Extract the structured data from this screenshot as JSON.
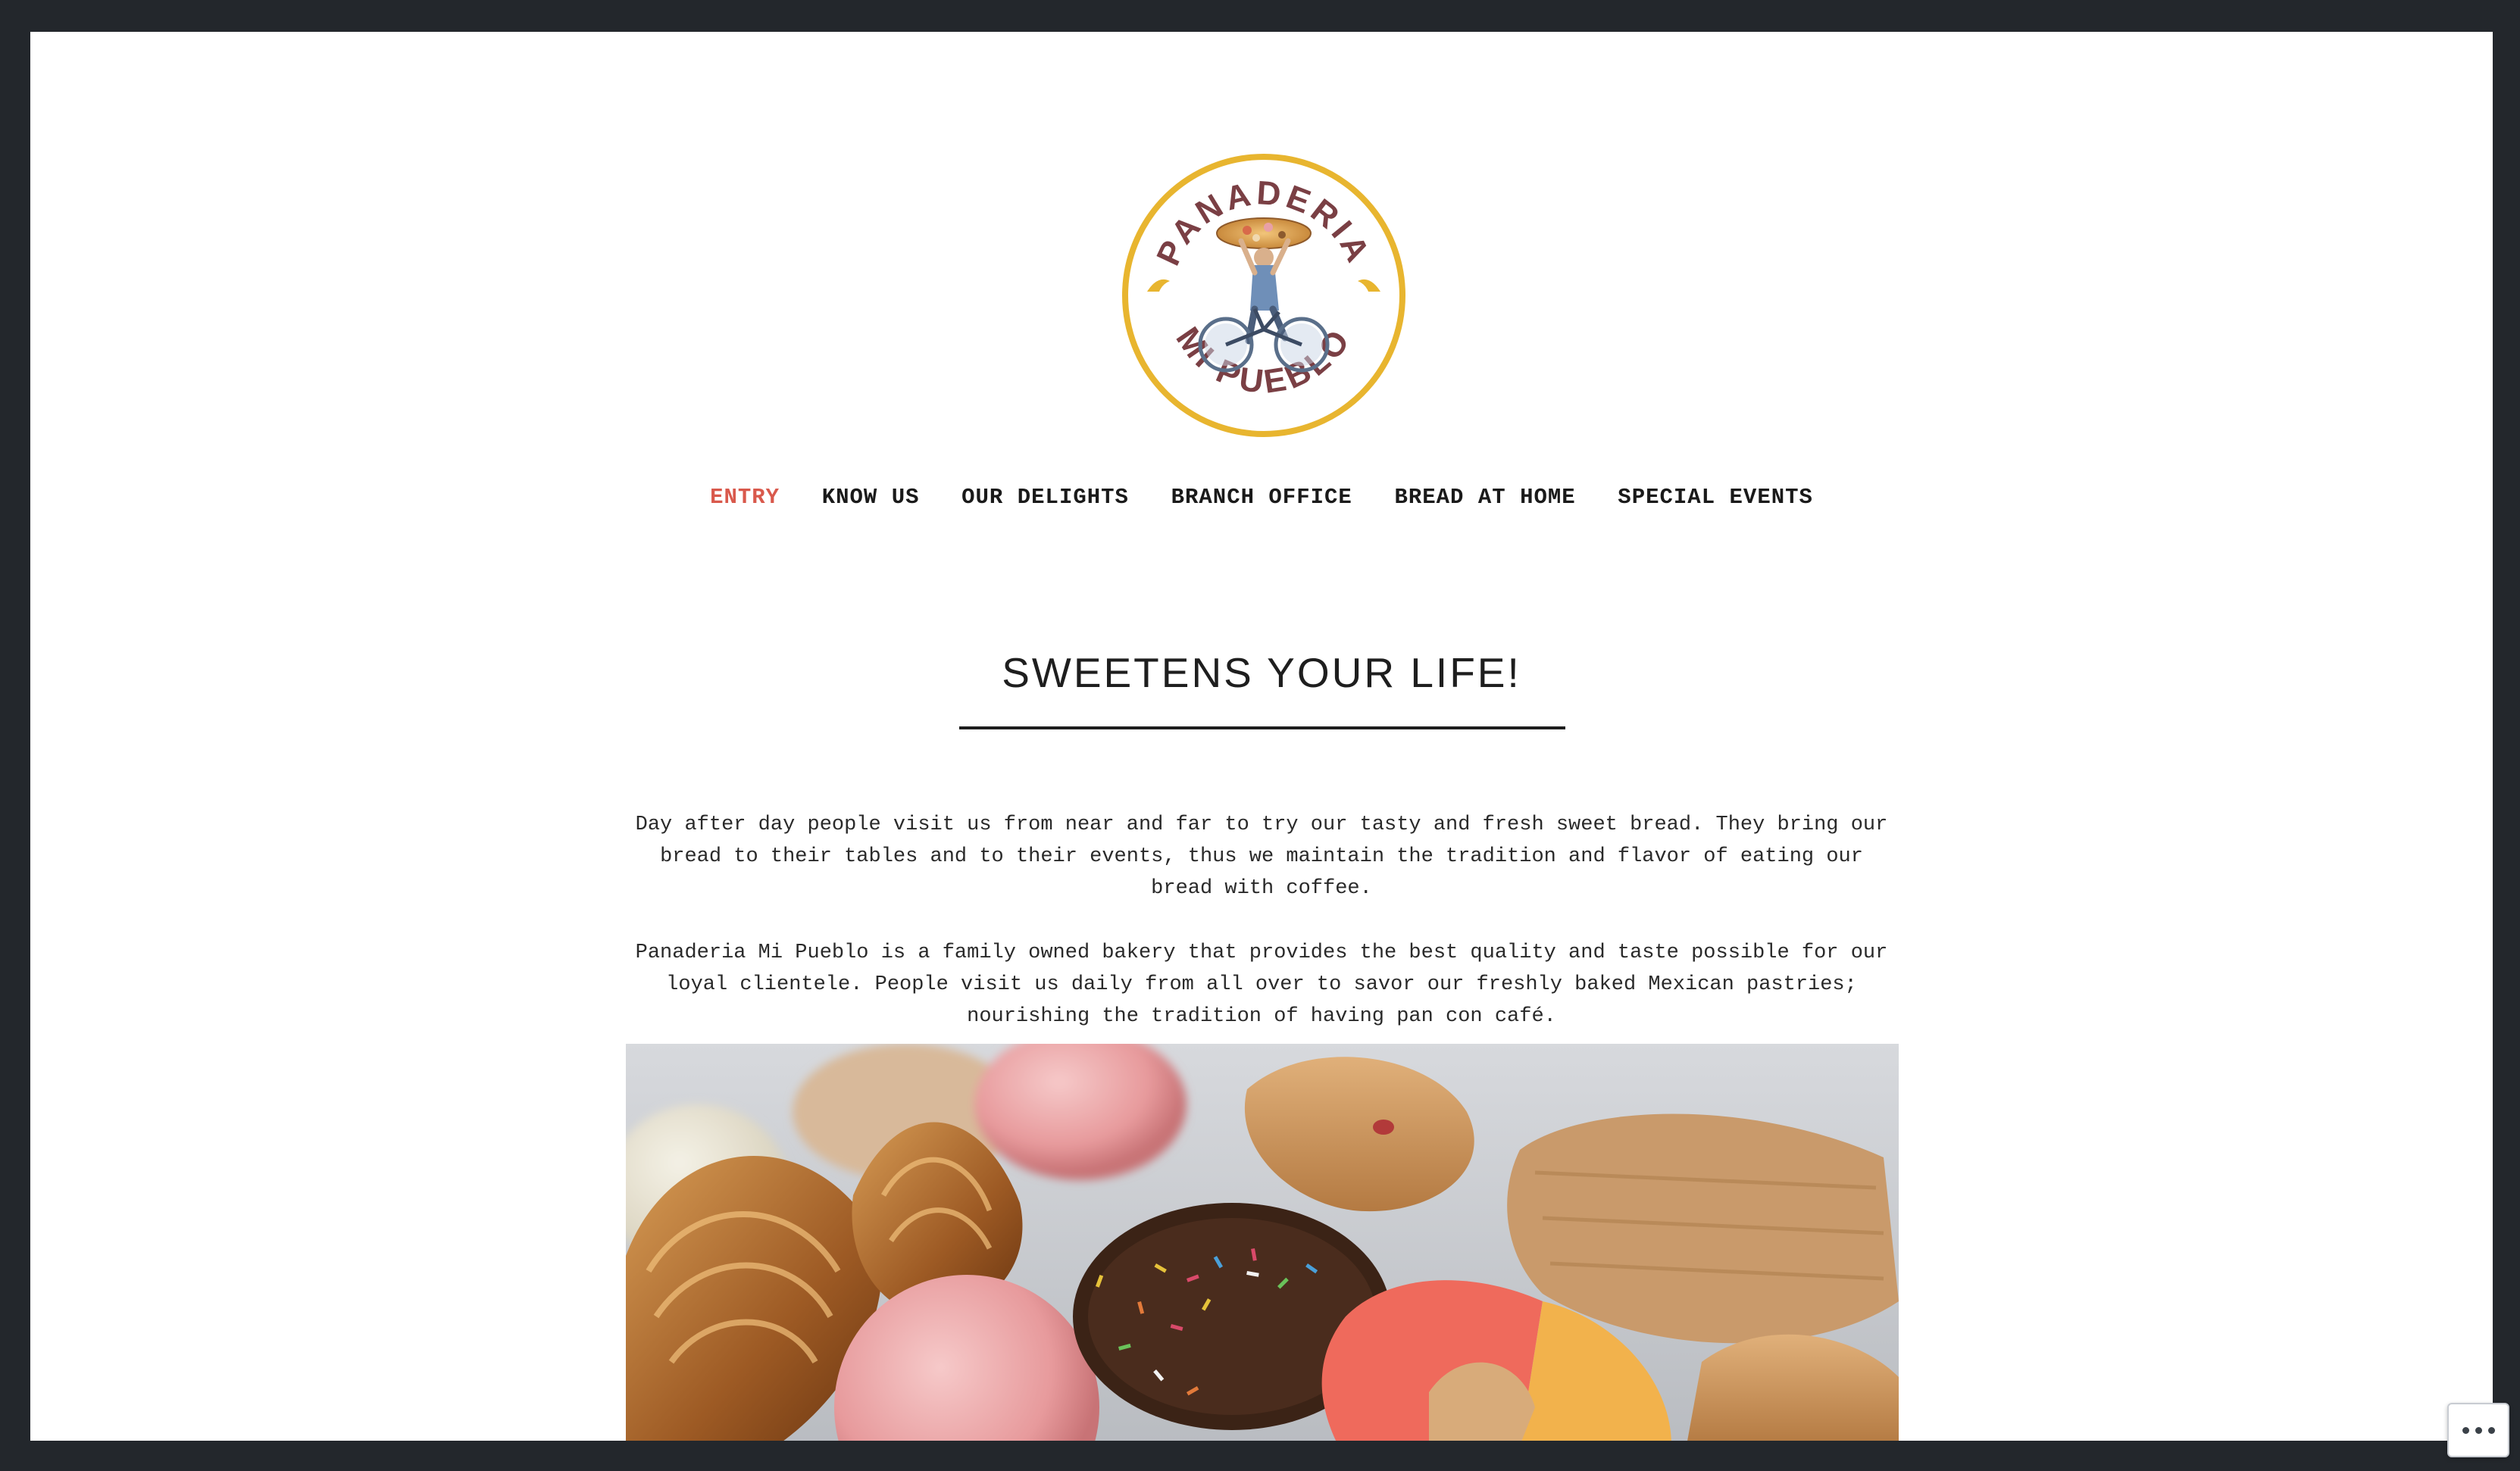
{
  "site": {
    "logo_top_text": "PANADERIA",
    "logo_bottom_text": "MI PUEBLO"
  },
  "nav": {
    "items": [
      {
        "label": "ENTRY",
        "active": true
      },
      {
        "label": "KNOW US",
        "active": false
      },
      {
        "label": "OUR DELIGHTS",
        "active": false
      },
      {
        "label": "BRANCH OFFICE",
        "active": false
      },
      {
        "label": "BREAD AT HOME",
        "active": false
      },
      {
        "label": "SPECIAL EVENTS",
        "active": false
      }
    ]
  },
  "main": {
    "title": "SWEETENS YOUR LIFE!",
    "paragraph1": "Day after day people visit us from near and far to try our tasty and fresh sweet bread. They bring our bread to their tables and to their events, thus we maintain the tradition and flavor of eating our bread with coffee.",
    "paragraph2": "Panaderia Mi Pueblo is a family owned bakery that provides the best quality and taste possible for our loyal clientele. People visit us daily from all over to savor our freshly baked Mexican pastries; nourishing the tradition of having pan con café."
  },
  "colors": {
    "frame": "#23272c",
    "nav_active": "#d9594c",
    "logo_ring": "#e8b52f",
    "logo_text": "#7a3f44"
  },
  "icons": {
    "widget": "more-dots-icon"
  }
}
